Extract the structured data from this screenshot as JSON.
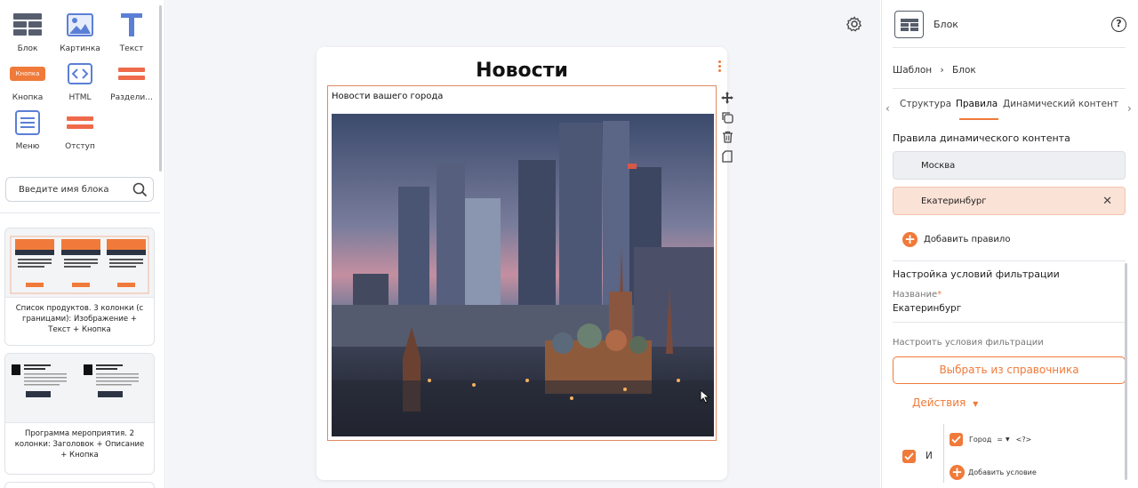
{
  "toolbox": {
    "tools": [
      {
        "label": "Блок",
        "icon": "block-grid-icon"
      },
      {
        "label": "Картинка",
        "icon": "image-icon"
      },
      {
        "label": "Текст",
        "icon": "text-icon"
      },
      {
        "label": "Кнопка",
        "icon": "button-icon",
        "chip": "Кнопка"
      },
      {
        "label": "HTML",
        "icon": "html-code-icon"
      },
      {
        "label": "Раздели...",
        "icon": "divider-icon"
      },
      {
        "label": "Меню",
        "icon": "menu-icon"
      },
      {
        "label": "Отступ",
        "icon": "spacer-icon"
      }
    ],
    "search_placeholder": "Введите имя блока",
    "cards": [
      {
        "caption": "Список продуктов. 3 колонки (с границами): Изображение + Текст + Кнопка"
      },
      {
        "caption": "Программа мероприятия. 2 колонки: Заголовок + Описание + Кнопка"
      }
    ]
  },
  "canvas": {
    "title": "Новости",
    "block_subtitle": "Новости вашего города"
  },
  "inspector": {
    "header_title": "Блок",
    "help": "?",
    "breadcrumb": {
      "parent": "Шаблон",
      "sep": "›",
      "current": "Блок"
    },
    "tabs": [
      "Структура",
      "Правила",
      "Динамический контент"
    ],
    "rules_title": "Правила динамического контента",
    "rules": [
      "Москва",
      "Екатеринбург"
    ],
    "rule_close": "✕",
    "add_rule": "Добавить правило",
    "filter_title": "Настройка условий фильтрации",
    "name_label": "Название",
    "name_value": "Екатеринбург",
    "configure_label": "Настроить условия фильтрации",
    "pick_button": "Выбрать из справочника",
    "actions": "Действия",
    "logic_and": "И",
    "condition": {
      "field": "Город",
      "op": "=",
      "value": "<?>"
    },
    "add_condition": "Добавить условие"
  },
  "colors": {
    "accent": "#f07a3a",
    "primary_icon": "#5b7fd6",
    "rule_selected": "#fbe2d6"
  }
}
